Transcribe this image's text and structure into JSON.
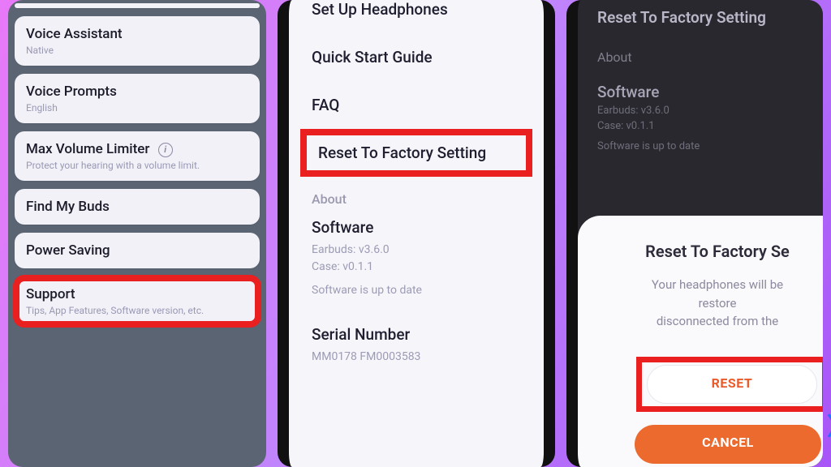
{
  "phone1": {
    "voice_assistant": {
      "title": "Voice Assistant",
      "subtitle": "Native"
    },
    "voice_prompts": {
      "title": "Voice Prompts",
      "subtitle": "English"
    },
    "max_volume": {
      "title": "Max Volume Limiter",
      "subtitle": "Protect your hearing with a volume limit."
    },
    "find_my_buds": {
      "title": "Find My Buds"
    },
    "power_saving": {
      "title": "Power Saving"
    },
    "support": {
      "title": "Support",
      "subtitle": "Tips, App Features, Software version, etc."
    }
  },
  "phone2": {
    "items": {
      "setup": "Set Up Headphones",
      "qsg": "Quick Start Guide",
      "faq": "FAQ",
      "reset": "Reset To Factory Setting"
    },
    "about_label": "About",
    "software": {
      "title": "Software",
      "line1": "Earbuds:  v3.6.0",
      "line2": "Case:  v0.1.1",
      "status": "Software is up to date"
    },
    "serial": {
      "title": "Serial Number",
      "value": "MM0178 FM0003583"
    }
  },
  "phone3": {
    "bg": {
      "header": "Reset To Factory Setting",
      "about_label": "About",
      "software": {
        "title": "Software",
        "line1": "Earbuds:  v3.6.0",
        "line2": "Case:  v0.1.1",
        "status": "Software is up to date"
      }
    },
    "sheet": {
      "title": "Reset To Factory Se",
      "message1": "Your headphones will be restore",
      "message2": "disconnected from the",
      "reset_label": "RESET",
      "cancel_label": "CANCEL"
    }
  }
}
